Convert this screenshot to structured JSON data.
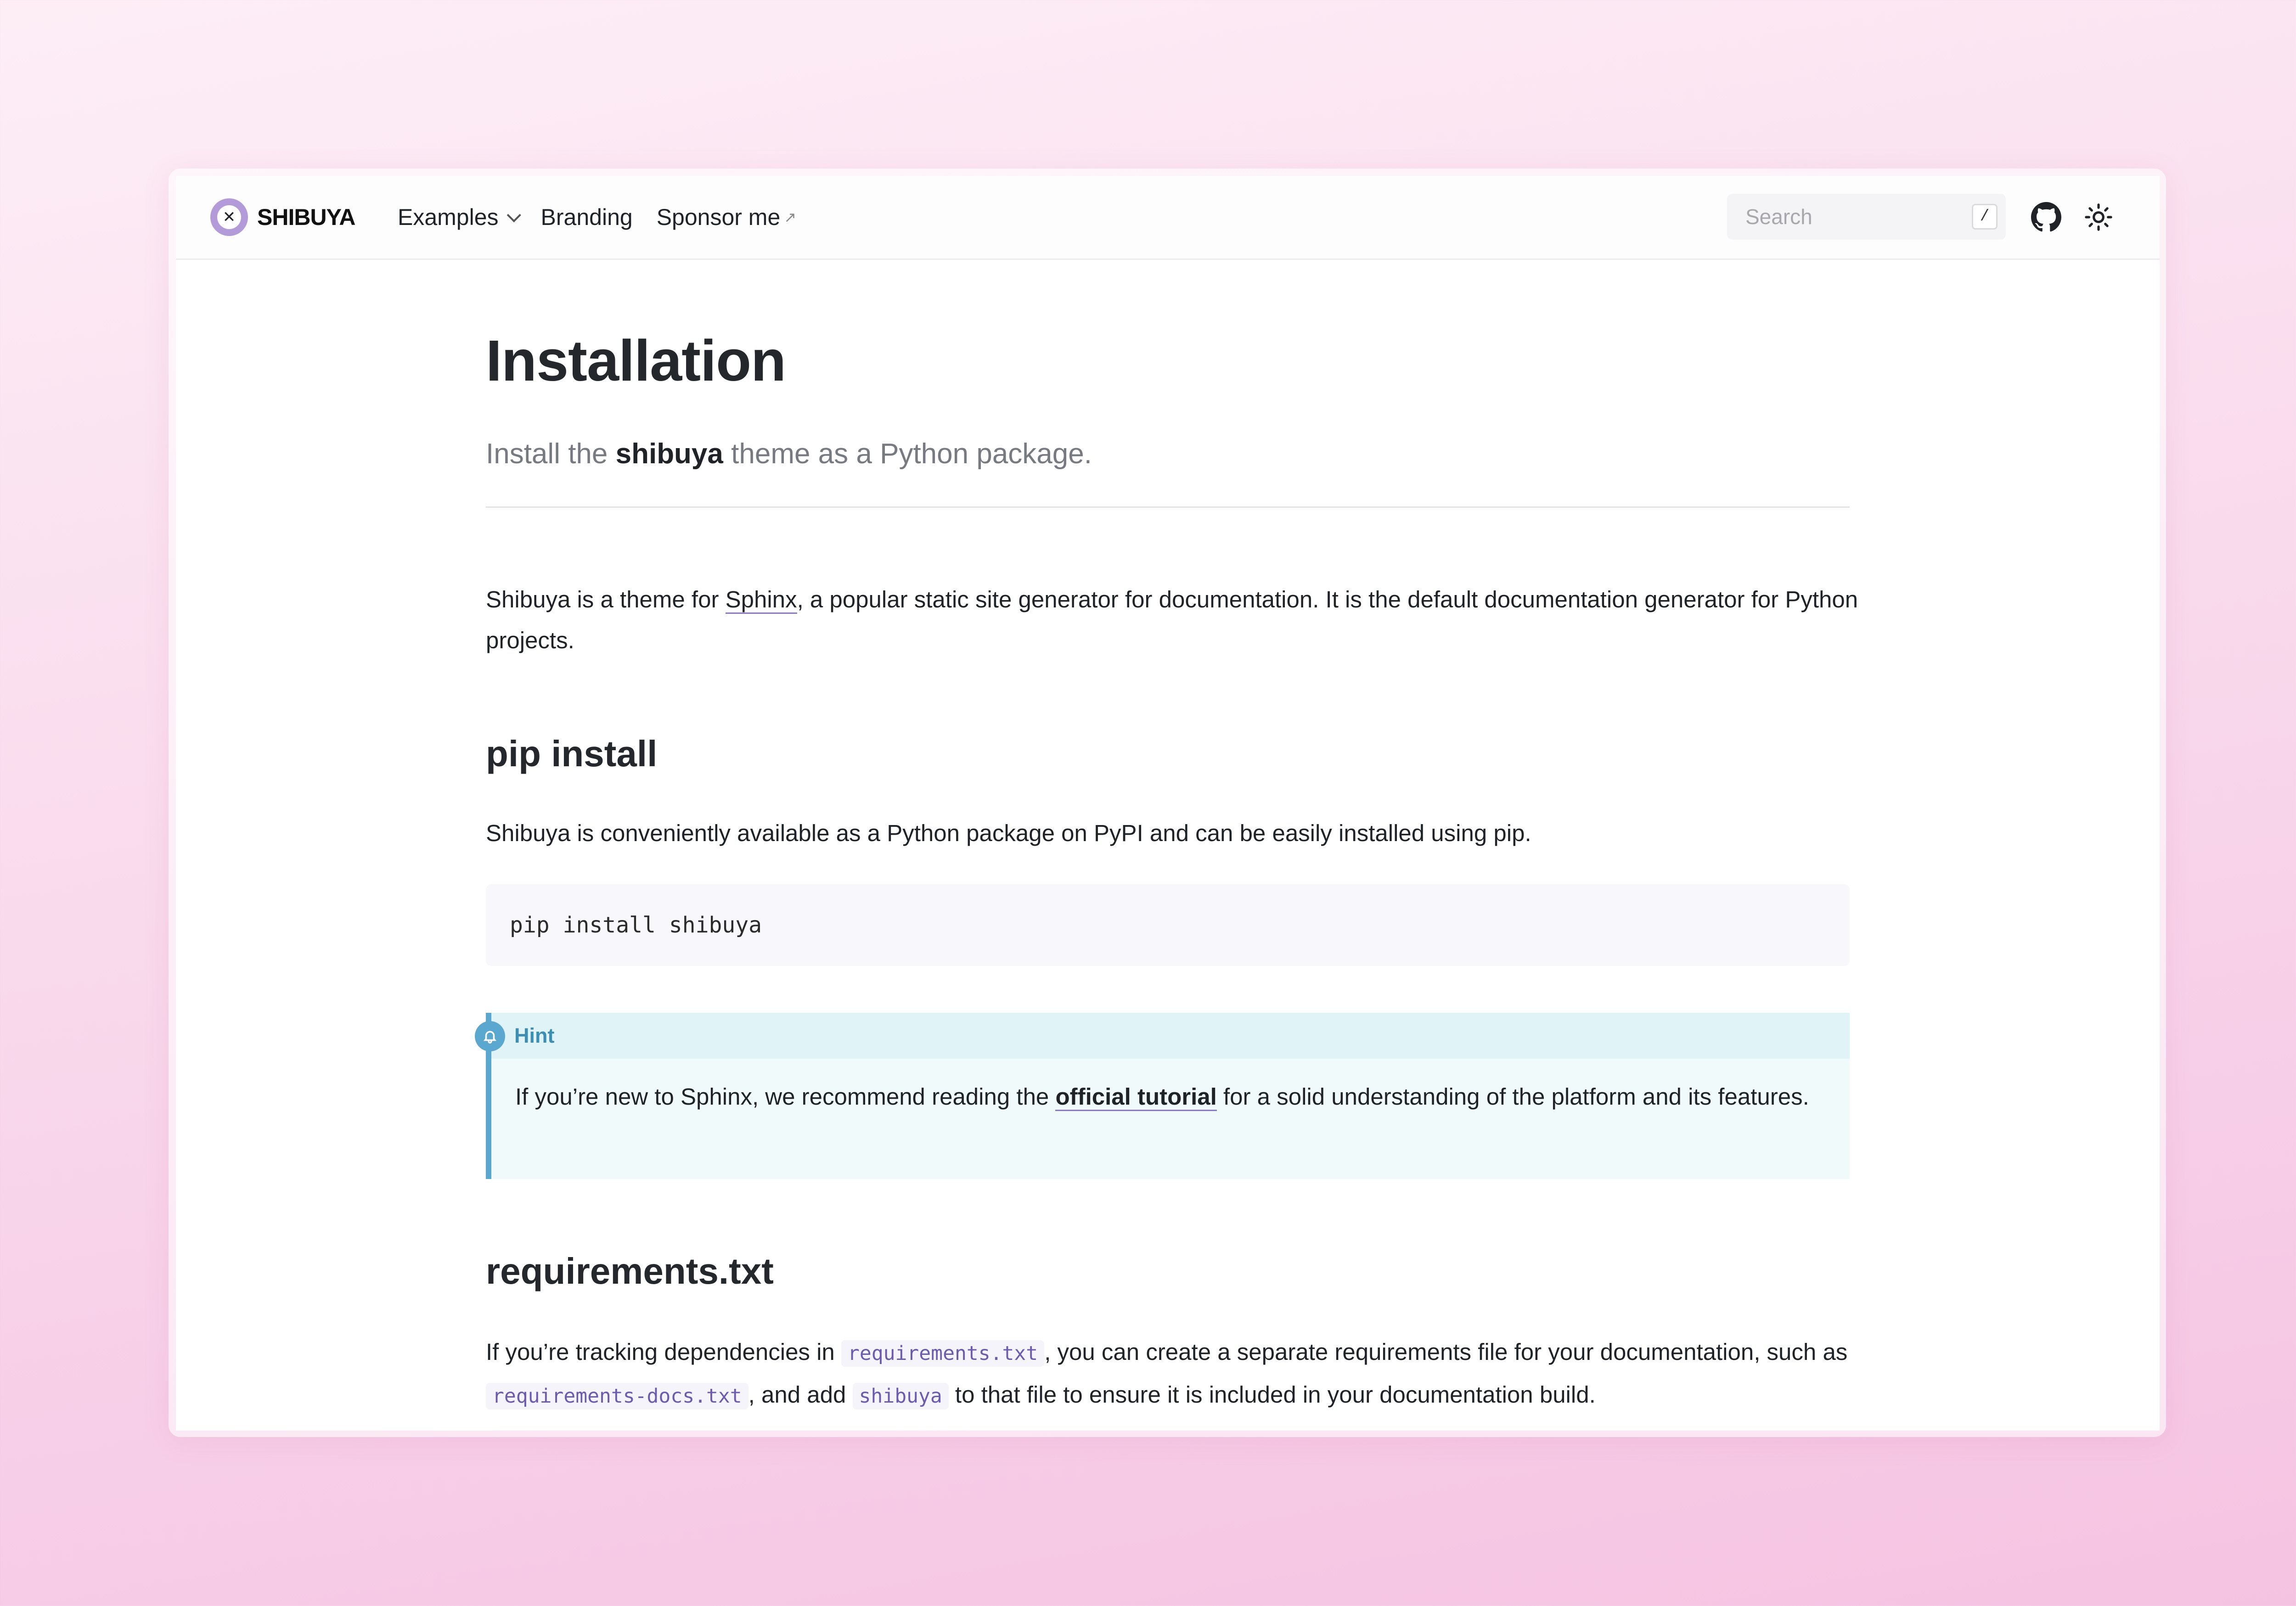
{
  "header": {
    "logo_text": "SHIBUYA",
    "nav": [
      {
        "label": "Examples"
      },
      {
        "label": "Branding"
      },
      {
        "label": "Sponsor me"
      }
    ],
    "search_placeholder": "Search",
    "search_shortcut": "/"
  },
  "page": {
    "title": "Installation",
    "lead_pre": "Install the ",
    "lead_bold": "shibuya",
    "lead_post": " theme as a Python package.",
    "intro_pre": "Shibuya is a theme for ",
    "intro_link": "Sphinx",
    "intro_post": ", a popular static site generator for documentation. It is the default documentation generator for Python projects.",
    "section1_title": "pip install",
    "section1_text": "Shibuya is conveniently available as a Python package on PyPI and can be easily installed using pip.",
    "code": "pip install shibuya",
    "hint_title": "Hint",
    "hint_pre": "If you’re new to Sphinx, we recommend reading the ",
    "hint_link": "official tutorial",
    "hint_post": " for a solid understanding of the platform and its features.",
    "section2_title": "requirements.txt",
    "req_t1": "If you’re tracking dependencies in ",
    "req_code1": "requirements.txt",
    "req_t2": ", you can create a separate requirements file for your documentation, such as ",
    "req_code2": "requirements-docs.txt",
    "req_t3": ", and add ",
    "req_code3": "shibuya",
    "req_t4": " to that file to ensure it is included in your documentation build."
  },
  "colors": {
    "accent": "#8c7ad0",
    "hint": "#5aa7cf",
    "background": "#f8d4ea"
  },
  "icons": [
    "shibuya-logo-icon",
    "chevron-down-icon",
    "external-link-icon",
    "github-icon",
    "sun-icon",
    "bell-icon"
  ]
}
